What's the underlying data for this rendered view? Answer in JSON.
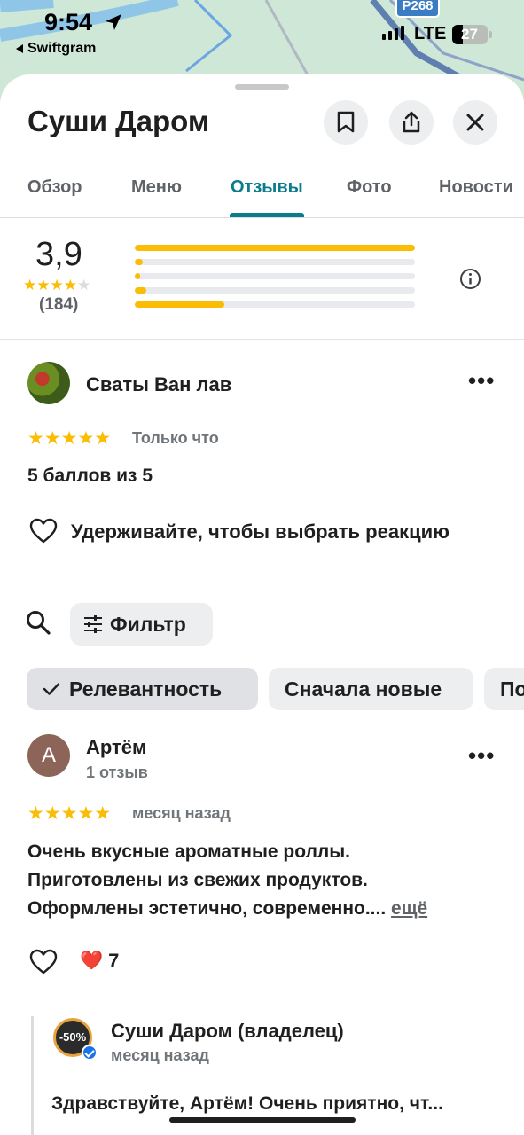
{
  "status_bar": {
    "time": "9:54",
    "back_app": "Swiftgram",
    "network": "LTE",
    "battery": "27",
    "road_badge": "P268"
  },
  "place": {
    "title": "Суши Даром"
  },
  "tabs": [
    {
      "label": "Обзор",
      "active": false
    },
    {
      "label": "Меню",
      "active": false
    },
    {
      "label": "Отзывы",
      "active": true
    },
    {
      "label": "Фото",
      "active": false
    },
    {
      "label": "Новости",
      "active": false
    }
  ],
  "rating_summary": {
    "average": "3,9",
    "stars": "★★★★",
    "empty_star": "★",
    "count": "(184)",
    "distribution": [
      {
        "stars": 5,
        "fraction": 1.0
      },
      {
        "stars": 4,
        "fraction": 0.03
      },
      {
        "stars": 3,
        "fraction": 0.01
      },
      {
        "stars": 2,
        "fraction": 0.04
      },
      {
        "stars": 1,
        "fraction": 0.32
      }
    ]
  },
  "my_review": {
    "author": "Сваты Ван лав",
    "stars": "★★★★★",
    "time": "Только что",
    "text": "5 баллов из 5",
    "reaction_hint": "Удерживайте, чтобы выбрать реакцию"
  },
  "controls": {
    "filter_label": "Фильтр",
    "sort_options": [
      {
        "label": "Релевантность",
        "selected": true
      },
      {
        "label": "Сначала новые",
        "selected": false
      },
      {
        "label": "По",
        "selected": false
      }
    ]
  },
  "reviews": [
    {
      "avatar_letter": "А",
      "author": "Артём",
      "subtitle": "1 отзыв",
      "stars": "★★★★★",
      "time": "месяц назад",
      "text_lines": [
        "Очень вкусные ароматные роллы.",
        "Приготовлены из свежих продуктов.",
        "Оформлены эстетично, современно...."
      ],
      "more_label": "ещё",
      "reaction_emoji": "❤️",
      "reaction_count": "7",
      "owner_reply": {
        "logo_text": "-50%",
        "author": "Суши Даром (владелец)",
        "time": "месяц назад",
        "text": "Здравствуйте, Артём! Очень приятно, чт..."
      }
    }
  ],
  "colors": {
    "accent": "#0b7d8a",
    "star": "#fbbc04",
    "chip_bg": "#edeef0"
  }
}
